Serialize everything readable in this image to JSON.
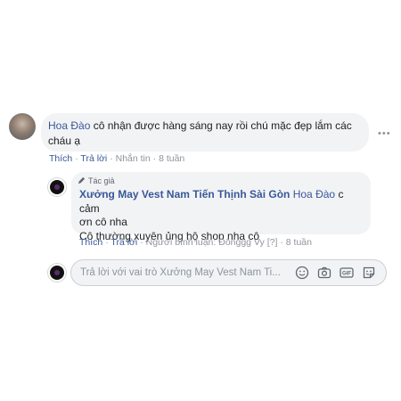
{
  "comment": {
    "author": "Hoa Đào",
    "text_line1": "cô nhận được hàng sáng nay rồi chú mặc đẹp lắm các",
    "text_line2": "cháu ạ",
    "more_icon": "…",
    "actions": {
      "like": "Thích",
      "reply": "Trả lời",
      "message": "Nhắn tin",
      "time": "8 tuần",
      "separator": "·"
    }
  },
  "reply": {
    "author_badge": "Tác giả",
    "author": "Xưởng May Vest Nam Tiến Thịnh Sài Gòn",
    "tagged": "Hoa Đào",
    "text_after_tag": "c cảm",
    "text_line2": "ơn cô nha",
    "text_line3": "Cô thường xuyên ủng hộ shop nha cô",
    "actions": {
      "like": "Thích",
      "reply": "Trả lời",
      "responder": "Người bình luận: Đônggg Vy",
      "edit_mark": "[?]",
      "time": "8 tuần",
      "separator": "·"
    }
  },
  "composer": {
    "placeholder": "Trả lời với vai trò Xưởng May Vest Nam Ti...",
    "icons": [
      "emoji-icon",
      "camera-icon",
      "gif-icon",
      "sticker-icon"
    ]
  }
}
